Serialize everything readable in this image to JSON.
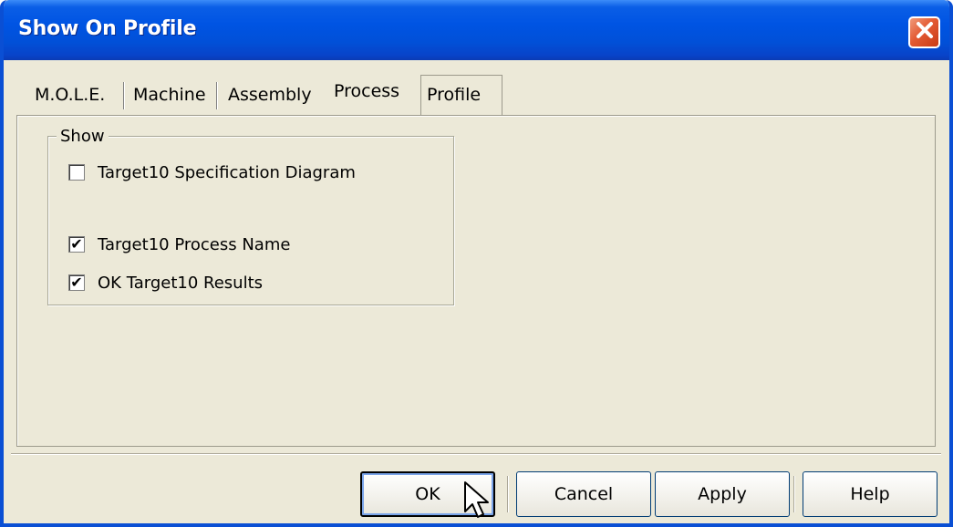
{
  "window": {
    "title": "Show On Profile"
  },
  "tabs": [
    {
      "label": "M.O.L.E.",
      "active": false
    },
    {
      "label": "Machine",
      "active": false
    },
    {
      "label": "Assembly",
      "active": false
    },
    {
      "label": "Process",
      "active": true
    },
    {
      "label": "Profile",
      "active": false
    }
  ],
  "group": {
    "legend": "Show",
    "options": [
      {
        "label": "Target10 Specification Diagram",
        "checked": false
      },
      {
        "label": "Target10 Process Name",
        "checked": true
      },
      {
        "label": "OK Target10 Results",
        "checked": true
      }
    ]
  },
  "buttons": {
    "ok": "OK",
    "cancel": "Cancel",
    "apply": "Apply",
    "help": "Help"
  },
  "glyphs": {
    "check": "✔",
    "close": "✕"
  },
  "colors": {
    "titlebar": "#0054e3",
    "dialog_bg": "#ece9d8",
    "close_button": "#e35a33"
  }
}
